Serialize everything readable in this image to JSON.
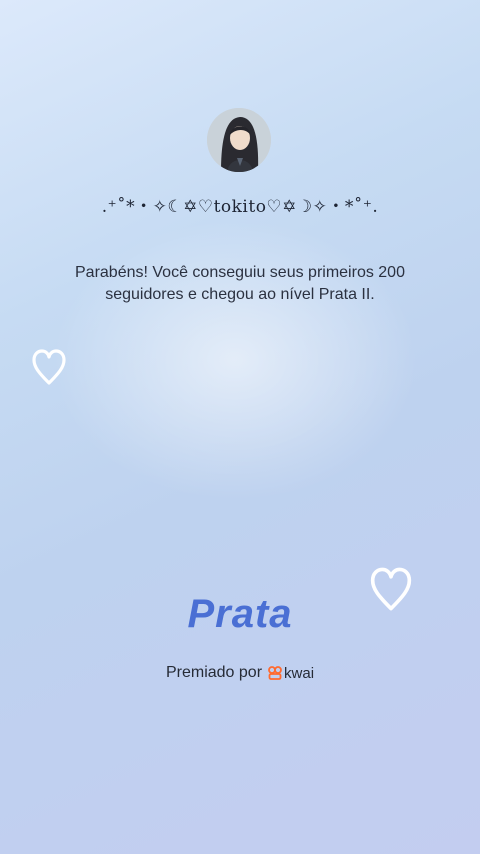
{
  "profile": {
    "username": ".⁺˚*・✧☾✡♡tokito♡✡☽✧・*˚⁺.",
    "avatar_icon": "avatar-icon"
  },
  "message": {
    "line1": "Parabéns! Você conseguiu seus primeiros 200",
    "line2": "seguidores e chegou ao nível Prata II."
  },
  "level": {
    "title": "Prata"
  },
  "award": {
    "prefix": "Premiado por",
    "brand_name": "kwai",
    "brand_color": "#ff6a2f"
  },
  "colors": {
    "accent": "#4a6fd4",
    "heart": "#ffffff"
  }
}
